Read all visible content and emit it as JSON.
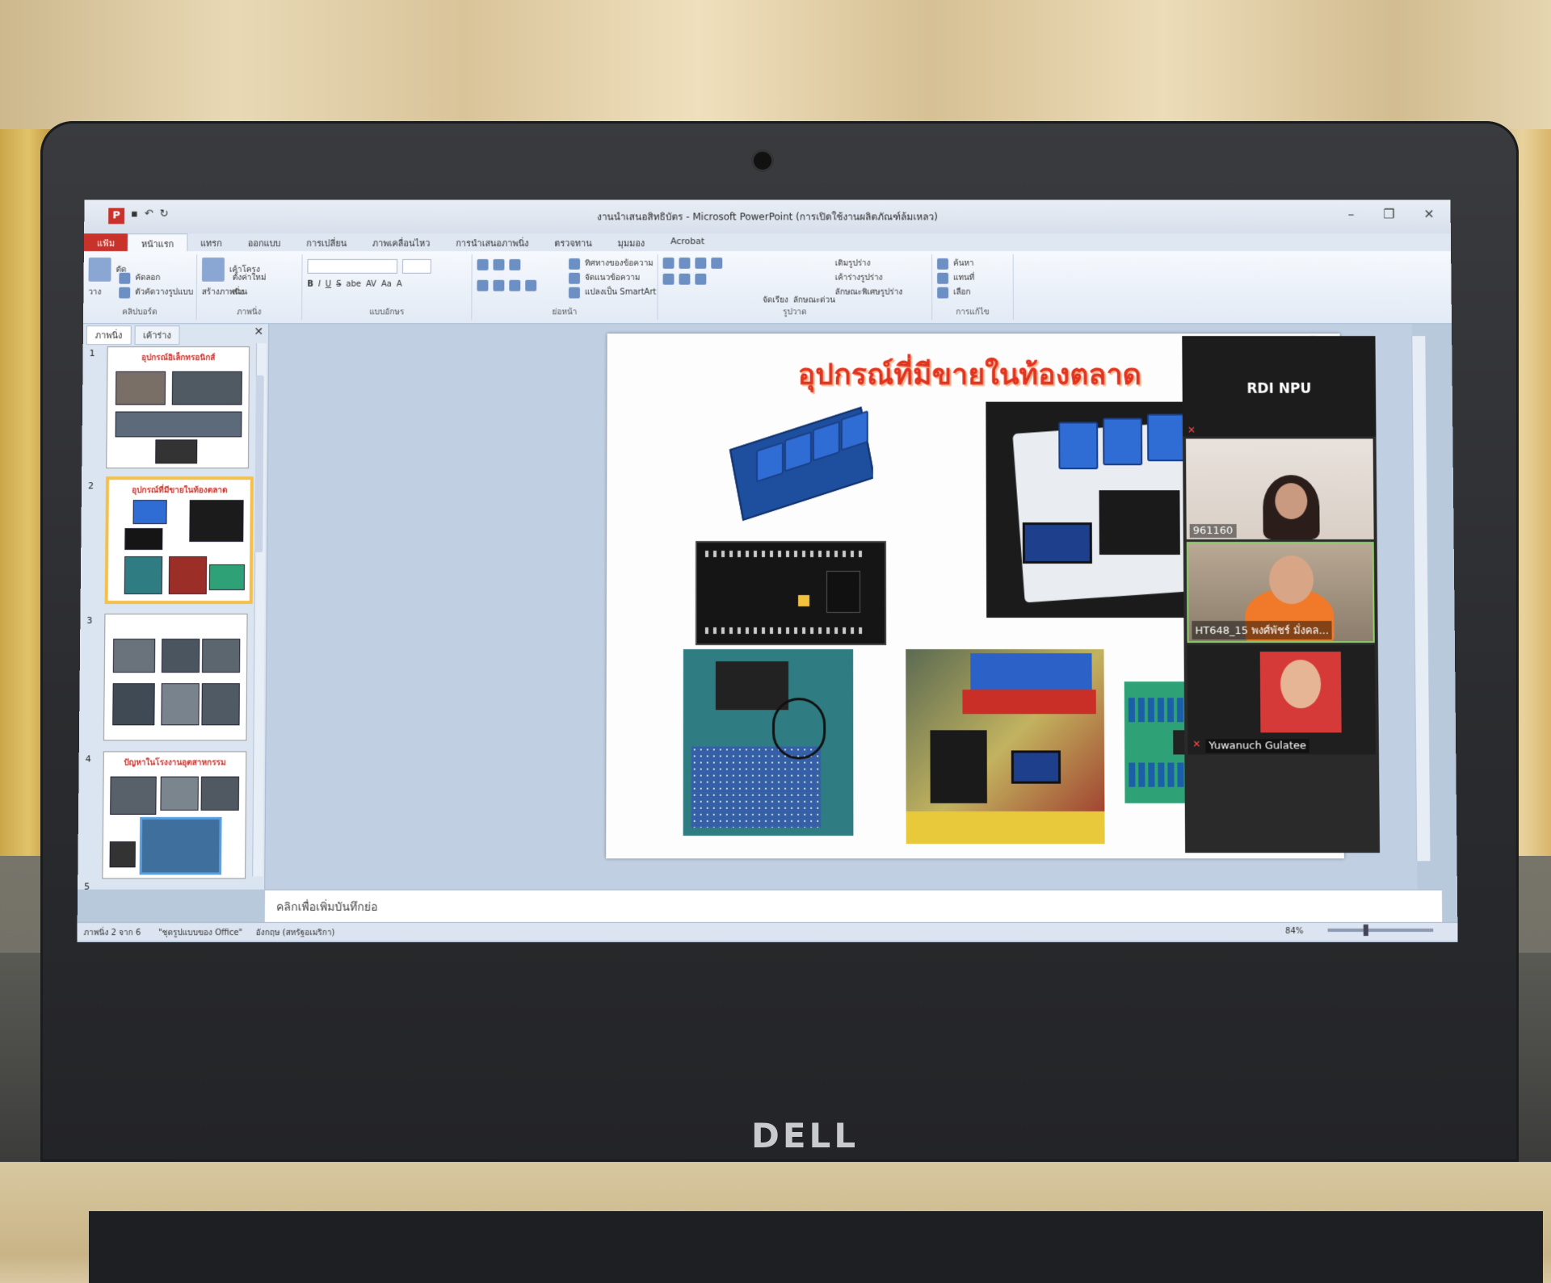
{
  "window": {
    "title": "งานนำเสนอสิทธิบัตร - Microsoft PowerPoint (การเปิดใช้งานผลิตภัณฑ์ล้มเหลว)",
    "controls": [
      "–",
      "❐",
      "✕"
    ]
  },
  "ribbon_tabs": [
    "แฟ้ม",
    "หน้าแรก",
    "แทรก",
    "ออกแบบ",
    "การเปลี่ยน",
    "ภาพเคลื่อนไหว",
    "การนำเสนอภาพนิ่ง",
    "ตรวจทาน",
    "มุมมอง",
    "Acrobat"
  ],
  "ribbon": {
    "groups": [
      {
        "label": "คลิปบอร์ด",
        "items": [
          "วาง",
          "ตัด",
          "คัดลอก",
          "ตัวคัดวางรูปแบบ"
        ]
      },
      {
        "label": "ภาพนิ่ง",
        "items": [
          "สร้างภาพนิ่ง",
          "เค้าโครง",
          "ตั้งค่าใหม่",
          "ส่วน"
        ]
      },
      {
        "label": "แบบอักษร",
        "items": [
          "B",
          "I",
          "U",
          "S",
          "abe",
          "AV",
          "Aa",
          "A"
        ]
      },
      {
        "label": "ย่อหน้า",
        "items": [
          "ทิศทางของข้อความ",
          "จัดแนวข้อความ",
          "แปลงเป็น SmartArt"
        ]
      },
      {
        "label": "รูปวาด",
        "items": [
          "จัดเรียง",
          "ลักษณะด่วน",
          "เติมรูปร่าง",
          "เค้าร่างรูปร่าง",
          "ลักษณะพิเศษรูปร่าง"
        ]
      },
      {
        "label": "การแก้ไข",
        "items": [
          "ค้นหา",
          "แทนที่",
          "เลือก"
        ]
      }
    ]
  },
  "left_panel": {
    "tabs": [
      "ภาพนิ่ง",
      "เค้าร่าง"
    ],
    "close": "✕",
    "thumbnails": [
      {
        "num": "1",
        "title": "อุปกรณ์อิเล็กทรอนิกส์"
      },
      {
        "num": "2",
        "title": "อุปกรณ์ที่มีขายในท้องตลาด"
      },
      {
        "num": "3",
        "title": ""
      },
      {
        "num": "4",
        "title": "ปัญหาในโรงงานอุตสาหกรรม"
      },
      {
        "num": "5",
        "title": ""
      }
    ]
  },
  "slide": {
    "title": "อุปกรณ์ที่มีขายในท้องตลาด"
  },
  "zoom_panel": {
    "host": "RDI NPU",
    "participants": [
      {
        "name": "961160"
      },
      {
        "name": "HT648_15 พงศ์พัชร์ มั่งคล..."
      },
      {
        "name": "Yuwanuch Gulatee"
      }
    ]
  },
  "notes": {
    "placeholder": "คลิกเพื่อเพิ่มบันทึกย่อ"
  },
  "status": {
    "slide_info": "ภาพนิ่ง 2 จาก 6",
    "theme": "\"ชุดรูปแบบของ Office\"",
    "language": "อังกฤษ (สหรัฐอเมริกา)",
    "zoom": "84%"
  },
  "brand": {
    "laptop_logo": "DELL"
  },
  "colors": {
    "slide_title": "#e2331f",
    "file_tab": "#c8322a",
    "selected_thumb": "#f4c04a"
  }
}
